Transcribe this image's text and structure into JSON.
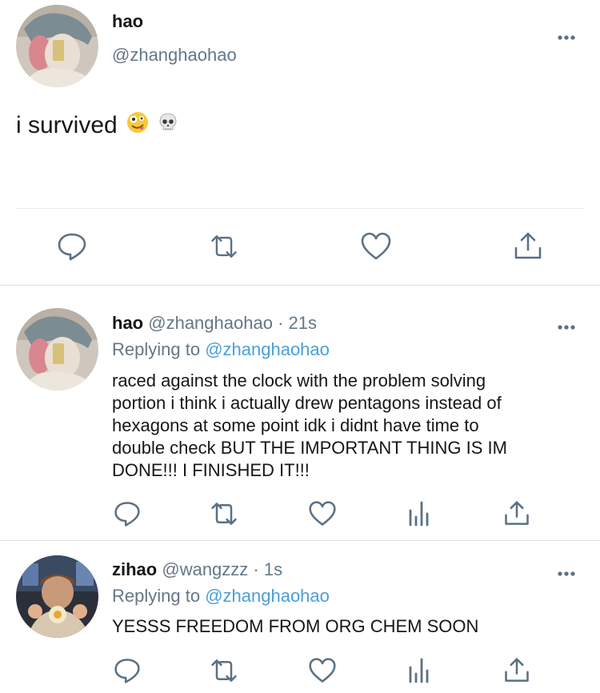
{
  "main_tweet": {
    "name": "hao",
    "handle": "@zhanghaohao",
    "text": "i survived",
    "emojis": [
      "zany-face-emoji",
      "skull-emoji"
    ]
  },
  "replies": [
    {
      "name": "hao",
      "handle": "@zhanghaohao",
      "separator": "·",
      "time": "21s",
      "replying_prefix": "Replying to",
      "replying_to": "@zhanghaohao",
      "lines": [
        "raced against the clock with the problem solving",
        "portion i think i actually drew pentagons instead of",
        "hexagons at some point idk i didnt have time to",
        "double check BUT THE IMPORTANT THING IS IM",
        "DONE!!! I FINISHED IT!!!"
      ]
    },
    {
      "name": "zihao",
      "handle": "@wangzzz",
      "separator": "·",
      "time": "1s",
      "replying_prefix": "Replying to",
      "replying_to": "@zhanghaohao",
      "lines": [
        "YESSS FREEDOM FROM ORG CHEM SOON"
      ]
    }
  ],
  "colors": {
    "text": "#14171a",
    "muted": "#657786",
    "link": "#4a9fd8",
    "icon": "#5b7083",
    "divider": "#e1e8ed"
  }
}
